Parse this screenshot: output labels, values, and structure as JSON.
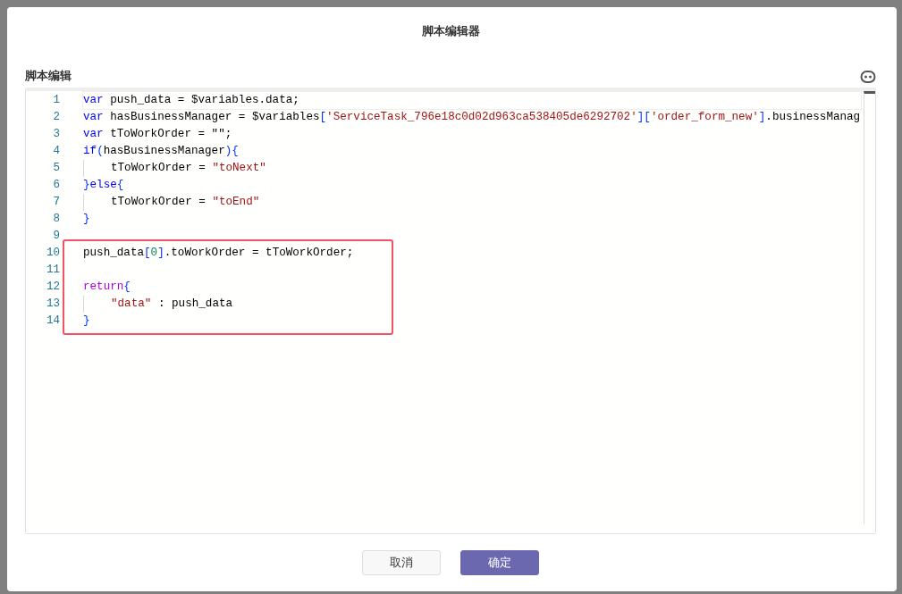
{
  "dialog": {
    "title": "脚本编辑器"
  },
  "editor": {
    "label": "脚本编辑",
    "blocks": [
      {
        "highlighted": false,
        "lines": [
          {
            "number": "1",
            "indented": false,
            "active": true,
            "tokens": [
              {
                "kind": "keyword",
                "text": "var"
              },
              {
                "kind": "plain",
                "text": " push_data = $variables.data;"
              }
            ]
          },
          {
            "number": "2",
            "indented": false,
            "active": false,
            "tokens": [
              {
                "kind": "keyword",
                "text": "var"
              },
              {
                "kind": "plain",
                "text": " hasBusinessManager = $variables"
              },
              {
                "kind": "bracket",
                "text": "["
              },
              {
                "kind": "string",
                "text": "'ServiceTask_796e18c0d02d963ca538405de6292702'"
              },
              {
                "kind": "bracket",
                "text": "]["
              },
              {
                "kind": "string",
                "text": "'order_form_new'"
              },
              {
                "kind": "bracket",
                "text": "]"
              },
              {
                "kind": "plain",
                "text": ".businessManag"
              }
            ]
          },
          {
            "number": "3",
            "indented": false,
            "active": false,
            "tokens": [
              {
                "kind": "keyword",
                "text": "var"
              },
              {
                "kind": "plain",
                "text": " tToWorkOrder = \"\";"
              }
            ]
          },
          {
            "number": "4",
            "indented": false,
            "active": false,
            "tokens": [
              {
                "kind": "keyword",
                "text": "if"
              },
              {
                "kind": "bracket",
                "text": "("
              },
              {
                "kind": "plain",
                "text": "hasBusinessManager"
              },
              {
                "kind": "bracket",
                "text": "){"
              }
            ]
          },
          {
            "number": "5",
            "indented": true,
            "active": false,
            "tokens": [
              {
                "kind": "plain",
                "text": "tToWorkOrder = "
              },
              {
                "kind": "string",
                "text": "\"toNext\""
              }
            ]
          },
          {
            "number": "6",
            "indented": false,
            "active": false,
            "tokens": [
              {
                "kind": "bracket",
                "text": "}"
              },
              {
                "kind": "keyword",
                "text": "else"
              },
              {
                "kind": "bracket",
                "text": "{"
              }
            ]
          },
          {
            "number": "7",
            "indented": true,
            "active": false,
            "tokens": [
              {
                "kind": "plain",
                "text": "tToWorkOrder = "
              },
              {
                "kind": "string",
                "text": "\"toEnd\""
              }
            ]
          },
          {
            "number": "8",
            "indented": false,
            "active": false,
            "tokens": [
              {
                "kind": "bracket",
                "text": "}"
              }
            ]
          },
          {
            "number": "9",
            "indented": false,
            "active": false
          }
        ]
      },
      {
        "highlighted": true,
        "lines": [
          {
            "number": "10",
            "indented": false,
            "active": false,
            "tokens": [
              {
                "kind": "plain",
                "text": "push_data"
              },
              {
                "kind": "bracket",
                "text": "["
              },
              {
                "kind": "number",
                "text": "0"
              },
              {
                "kind": "bracket",
                "text": "]"
              },
              {
                "kind": "plain",
                "text": ".toWorkOrder = tToWorkOrder;"
              }
            ]
          },
          {
            "number": "11",
            "indented": false,
            "active": false
          },
          {
            "number": "12",
            "indented": false,
            "active": false,
            "tokens": [
              {
                "kind": "control",
                "text": "return"
              },
              {
                "kind": "bracket",
                "text": "{"
              }
            ]
          },
          {
            "number": "13",
            "indented": true,
            "active": false,
            "tokens": [
              {
                "kind": "string",
                "text": "\"data\""
              },
              {
                "kind": "plain",
                "text": " : push_data"
              }
            ]
          },
          {
            "number": "14",
            "indented": false,
            "active": false,
            "tokens": [
              {
                "kind": "bracket",
                "text": "}"
              }
            ]
          }
        ]
      }
    ]
  },
  "buttons": [
    {
      "label": "取消",
      "kind": "secondary"
    },
    {
      "label": "确定",
      "kind": "primary"
    }
  ]
}
